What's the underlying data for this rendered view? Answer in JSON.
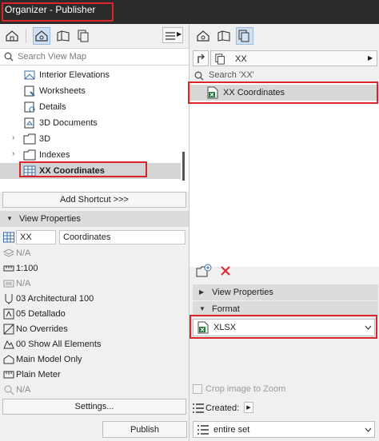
{
  "window": {
    "title": "Organizer - Publisher"
  },
  "left": {
    "search_placeholder": "Search View Map",
    "tree": [
      {
        "label": "Interior Elevations",
        "icon": "interior-elevation-icon"
      },
      {
        "label": "Worksheets",
        "icon": "worksheet-icon"
      },
      {
        "label": "Details",
        "icon": "detail-icon"
      },
      {
        "label": "3D Documents",
        "icon": "3d-document-icon"
      },
      {
        "label": "3D",
        "icon": "folder-icon"
      },
      {
        "label": "Indexes",
        "icon": "folder-icon"
      },
      {
        "label": "XX Coordinates",
        "icon": "schedule-icon"
      }
    ],
    "add_shortcut": "Add Shortcut >>>",
    "view_properties_title": "View Properties",
    "id_value": "XX",
    "name_value": "Coordinates",
    "props": [
      {
        "text": "N/A",
        "dim": true
      },
      {
        "text": "1:100",
        "dim": false
      },
      {
        "text": "N/A",
        "dim": true
      },
      {
        "text": "03 Architectural 100",
        "dim": false
      },
      {
        "text": "05 Detallado",
        "dim": false
      },
      {
        "text": "No Overrides",
        "dim": false
      },
      {
        "text": "00 Show All Elements",
        "dim": false
      },
      {
        "text": "Main Model Only",
        "dim": false
      },
      {
        "text": "Plain Meter",
        "dim": false
      },
      {
        "text": "N/A",
        "dim": true
      }
    ],
    "settings_label": "Settings...",
    "publish_label": "Publish"
  },
  "right": {
    "set_name": "XX",
    "search_placeholder": "Search 'XX'",
    "items": [
      {
        "label": "XX Coordinates"
      }
    ],
    "view_properties_title": "View Properties",
    "format_title": "Format",
    "format_value": "XLSX",
    "crop_label": "Crop image to Zoom",
    "created_label": "Created:",
    "set_select": "entire set"
  },
  "colors": {
    "highlight_red": "#d9262c",
    "selection_gray": "#d4d4d4",
    "excel_green": "#1e7a3c"
  }
}
